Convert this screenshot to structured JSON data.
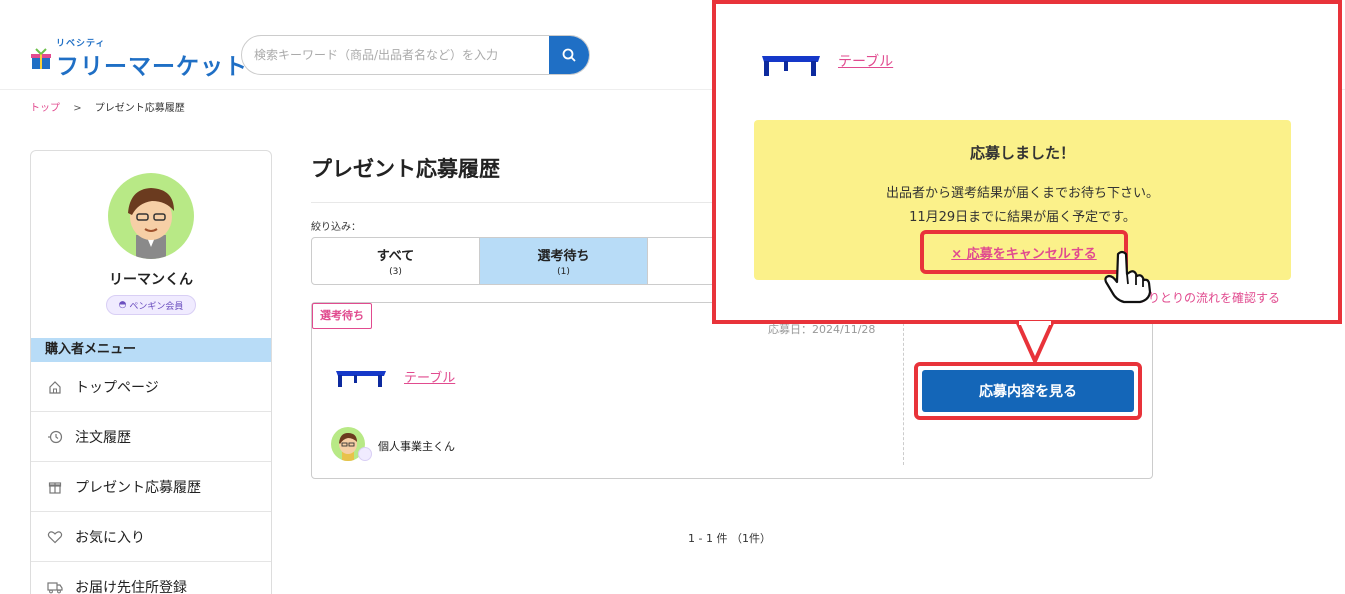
{
  "colors": {
    "brand_blue": "#1f6fc5",
    "link_pink": "#e14b8f",
    "highlight_red": "#e8333a",
    "tab_active": "#b8dcf7",
    "notice_yellow": "#fbf18a"
  },
  "header": {
    "logo_small": "リベシティ",
    "logo_main": "フリーマーケット",
    "search_placeholder": "検索キーワード（商品/出品者名など）を入力",
    "search_icon": "search-icon"
  },
  "breadcrumb": {
    "home": "トップ",
    "separator": ">",
    "current": "プレゼント応募履歴"
  },
  "sidebar": {
    "user_name": "リーマンくん",
    "member_badge": "ペンギン会員",
    "menu_header": "購入者メニュー",
    "items": [
      {
        "label": "トップページ",
        "icon": "home-icon"
      },
      {
        "label": "注文履歴",
        "icon": "history-icon"
      },
      {
        "label": "プレゼント応募履歴",
        "icon": "gift-icon"
      },
      {
        "label": "お気に入り",
        "icon": "heart-icon"
      },
      {
        "label": "お届け先住所登録",
        "icon": "truck-icon"
      }
    ]
  },
  "main": {
    "title": "プレゼント応募履歴",
    "filter_label": "絞り込み：",
    "tabs": [
      {
        "label": "すべて",
        "count": "(3)"
      },
      {
        "label": "選考待ち",
        "count": "(1)"
      }
    ],
    "entry": {
      "status": "選考待ち",
      "applied_date": "応募日：2024/11/28",
      "item_name": "テーブル",
      "seller_name": "個人事業主くん",
      "view_button": "応募内容を見る"
    },
    "pagination": "1 - 1 件 （1件）"
  },
  "popup": {
    "item_name": "テーブル",
    "notice_title": "応募しました！",
    "notice_line1": "出品者から選考結果が届くまでお待ち下さい。",
    "notice_line2": "11月29日までに結果が届く予定です。",
    "cancel_link": "× 応募をキャンセルする",
    "flow_link": "やりとりの流れを確認する"
  }
}
